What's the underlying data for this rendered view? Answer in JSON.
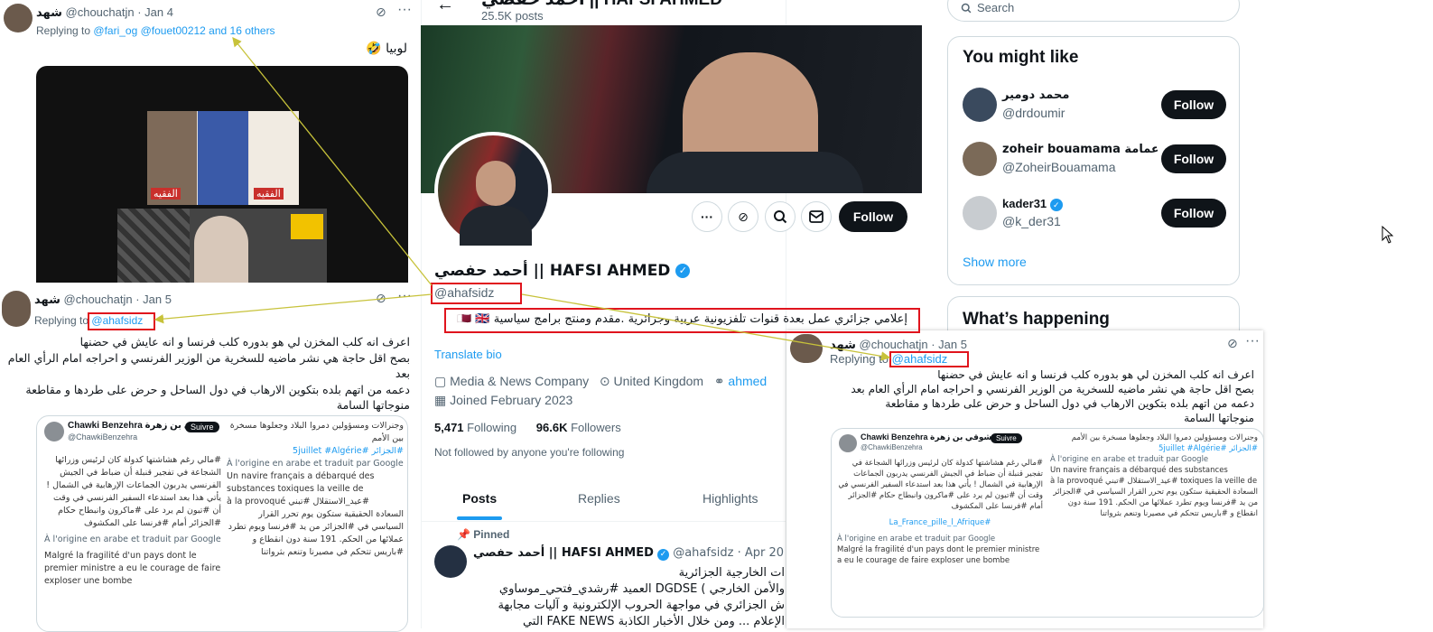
{
  "tweet_top": {
    "name": "شهد",
    "handle": "@chouchatjn",
    "date": "· Jan 4",
    "replying_prefix": "Replying to",
    "replying_targets": "@fari_og @fouet00212 and 16 others",
    "text": "لوبيا 🤣",
    "media_labels": [
      "الفقيه",
      "الفقيه"
    ]
  },
  "tweet_left": {
    "name": "شهد",
    "handle": "@chouchatjn",
    "date": "· Jan 5",
    "replying_prefix": "Replying to",
    "replying_target": "@ahafsidz",
    "text": "اعرف انه كلب المخزن لي هو بدوره كلب فرنسا و انه عايش في حضنها\nبصح اقل حاجة هي نشر ماضيه للسخرية من الوزير الفرنسي و احراجه امام الرأي العام بعد\nدعمه من اتهم بلده بتكوين الارهاب في دول الساحل و حرض على طردها و مقاطعة\nمنوجاتها السامة"
  },
  "tweet_right": {
    "name": "شهد",
    "handle": "@chouchatjn",
    "date": "· Jan 5",
    "replying_prefix": "Replying to",
    "replying_target": "@ahafsidz",
    "text": "اعرف انه كلب المخزن لي هو بدوره كلب فرنسا و انه عايش في حضنها\nبصح اقل حاجة هي نشر ماضيه للسخرية من الوزير الفرنسي و احراجه امام الرأي العام بعد\nدعمه من اتهم بلده بتكوين الارهاب في دول الساحل و حرض على طردها و مقاطعة\nمنوجاتها السامة"
  },
  "embedded_post": {
    "name": "Chawki Benzehra شوقي بن زهرة",
    "handle": "@ChawkiBenzehra",
    "follow": "Suivre",
    "col_left": [
      "#مالي رغم هشاشتها كدولة كان لرئيس وزرائها الشجاعة في تفجير قنبلة أن ضباط في الجيش الفرنسي يدربون الجماعات الإرهابية في الشمال ! يأتي هذا بعد استدعاء السفير الفرنسي في وقت أن #تبون لم يرد على #ماكرون وانبطاح حكام #الجزائر أمام #فرنسا على المكشوف",
      "À l'origine en arabe et traduit par Google",
      "Malgré la fragilité d'un pays dont le premier ministre a eu le courage de faire exploser une bombe"
    ],
    "col_right": [
      "وجنرالات ومسؤولين دمروا البلاد وجعلوها مسخرة بين الأمم",
      "#الجزائر #5juillet #Algérie",
      "À l'origine en arabe et traduit par Google",
      "Un navire français a débarqué des substances toxiques la veille de #عيد_الاستقلال #تبني à la provoqué",
      "السعادة الحقيقية ستكون يوم تحرر القرار السياسي في #الجزائر من يد #فرنسا ويوم تطرد عملائها من الحكم. 191 سنة دون انقطاع و #باريس تتحكم في مصيرنا وتنعم بثرواتنا",
      "#La_France_pille_l_Afrique"
    ]
  },
  "profile": {
    "header_name": "أحمد حفصي || HAFSI AHMED",
    "posts_count": "25.5K posts",
    "display_name": "أحمد حفصي || HAFSI AHMED",
    "handle": "@ahafsidz",
    "bio": "إعلامي جزائري عمل بعدة قنوات تلفزيونية عربية وجزائرية .مقدم ومنتج برامج سياسية 🇶🇦 🇬🇧",
    "translate": "Translate bio",
    "category": "Media & News Company",
    "location": "United Kingdom",
    "website": "ahmed",
    "joined": "Joined February 2023",
    "following_count": "5,471",
    "following_label": "Following",
    "followers_count": "96.6K",
    "followers_label": "Followers",
    "not_followed": "Not followed by anyone you're following",
    "follow_label": "Follow",
    "tabs": [
      "Posts",
      "Replies",
      "Highlights"
    ],
    "pinned_label": "Pinned",
    "pinned_name": "أحمد حفصي || HAFSI AHMED",
    "pinned_handle": "@ahafsidz",
    "pinned_date": "· Apr 20",
    "pinned_lines": [
      "ات الخارجية الجزائرية",
      "والأمن الخارجي ) DGDSE العميد #رشدي_فتحي_موساوي",
      "ش الجزائري في مواجهة الحروب الإلكترونية و آليات مجابهة",
      "الإعلام ... ومن خلال الأخبار الكاذبة FAKE NEWS التي"
    ]
  },
  "sidebar": {
    "search_placeholder": "Search",
    "you_might_like": "You might like",
    "suggestions": [
      {
        "name": "محمد دومير",
        "handle": "@drdoumir",
        "follow": "Follow"
      },
      {
        "name": "zoheir bouamama زهير بوعمامة",
        "handle": "@ZoheirBouamama",
        "follow": "Follow"
      },
      {
        "name": "kader31",
        "handle": "@k_der31",
        "follow": "Follow"
      }
    ],
    "show_more": "Show more",
    "whats_happening": "What’s happening"
  },
  "colors": {
    "accent": "#1d9bf0",
    "annotation_red": "#e0141d",
    "annotation_arrow": "#c7c23a",
    "verified": "#1d9bf0"
  }
}
